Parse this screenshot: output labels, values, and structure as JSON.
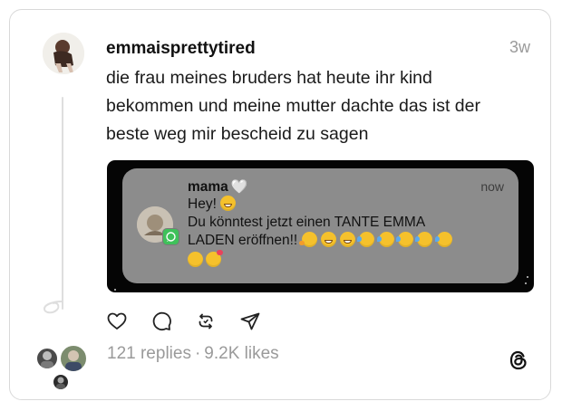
{
  "post": {
    "username": "emmaisprettytired",
    "time": "3w",
    "text": "die frau meines bruders hat heute ihr kind bekommen und meine mutter dachte das ist der beste weg mir bescheid zu sagen"
  },
  "notification": {
    "sender": "mama",
    "sender_emoji": "🤍",
    "time": "now",
    "line1": "Hey!",
    "line2": "Du könntest jetzt einen TANTE EMMA",
    "line3": "LADEN eröffnen!!",
    "app_icon": "whatsapp-icon"
  },
  "footer": {
    "replies": "121 replies",
    "separator": "·",
    "likes": "9.2K likes"
  },
  "icons": {
    "like": "heart-icon",
    "reply": "comment-icon",
    "repost": "repost-icon",
    "share": "send-icon",
    "brand": "threads-logo-icon"
  },
  "colors": {
    "muted": "#9a9a9a",
    "notification_bg": "#8c8c8c",
    "media_bg": "#050505",
    "whatsapp": "#3fc15a"
  }
}
